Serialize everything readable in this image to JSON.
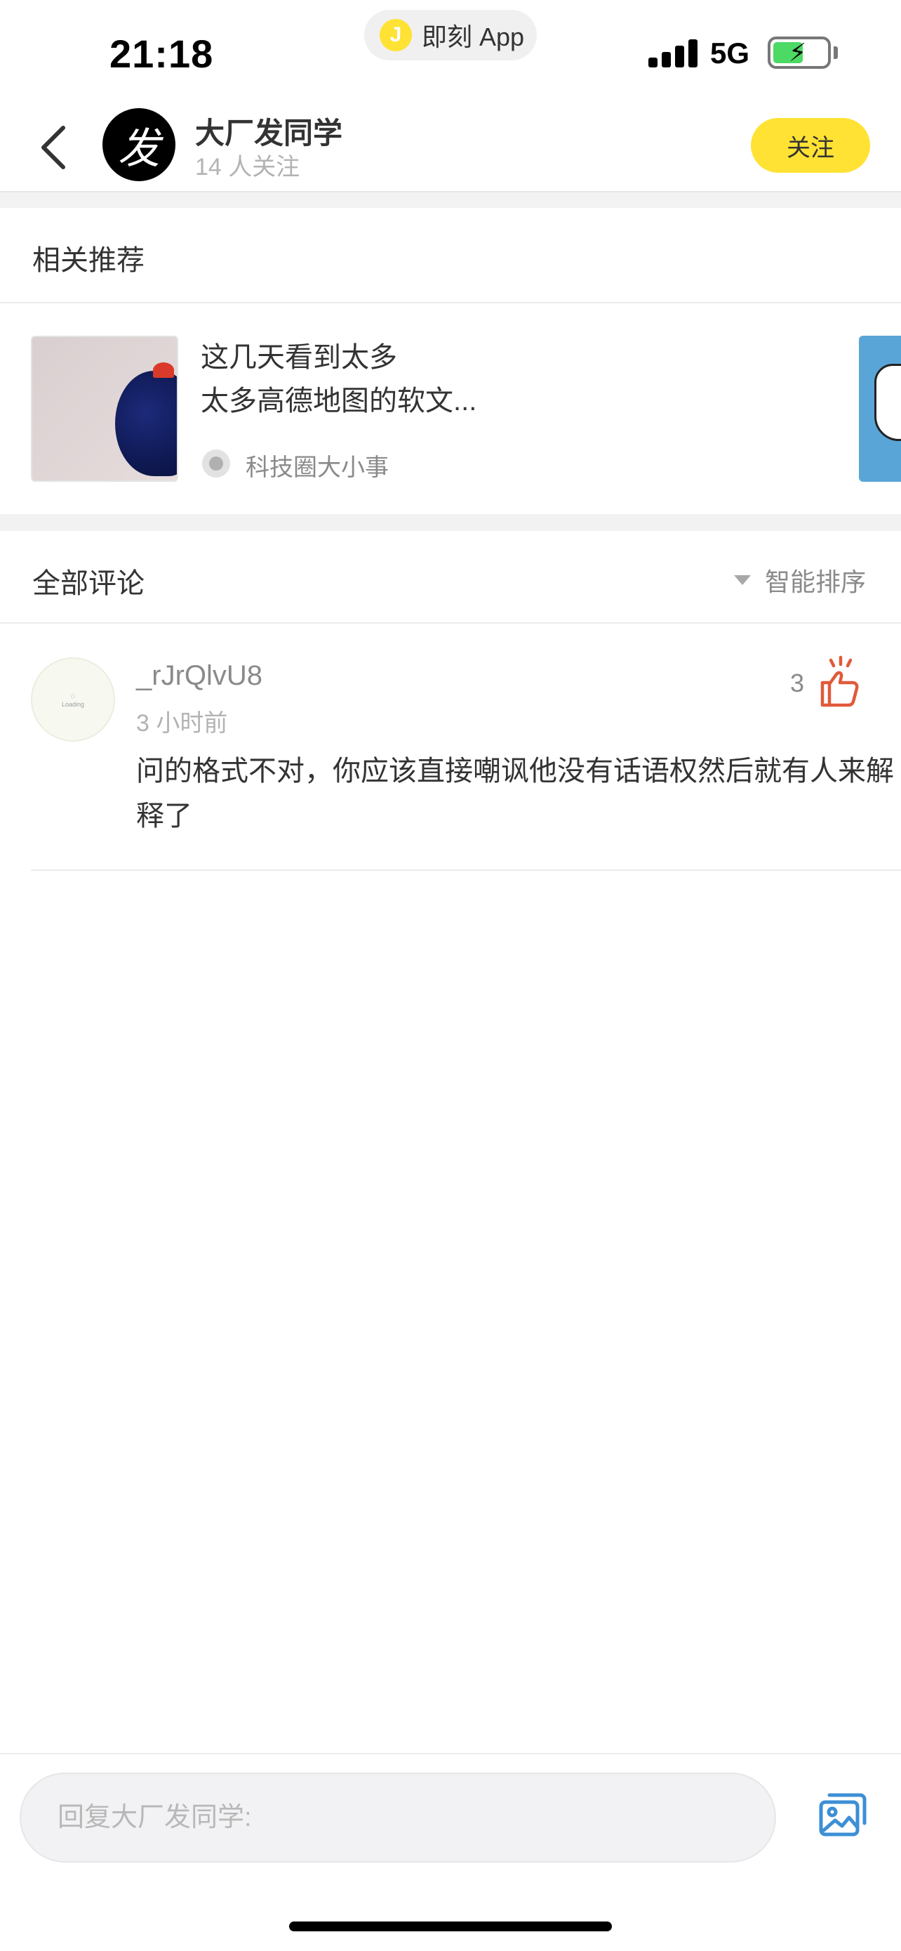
{
  "status_bar": {
    "time": "21:18",
    "app_pill_label": "即刻 App",
    "app_pill_logo": "J",
    "network": "5G",
    "icons": [
      "signal-icon",
      "battery-charging-icon"
    ]
  },
  "header": {
    "back_icon": "chevron-left-icon",
    "topic_avatar_glyph": "发",
    "topic_name": "大厂发同学",
    "followers": "14 人关注",
    "follow_label": "关注",
    "accent_color": "#ffe234"
  },
  "recommendations": {
    "title": "相关推荐",
    "items": [
      {
        "title": "这几天看到太多\n太多高德地图的软文...",
        "source": "科技圈大小事"
      }
    ]
  },
  "comments": {
    "title": "全部评论",
    "sort_label": "智能排序",
    "items": [
      {
        "avatar_loading_text": "Loading",
        "username": "_rJrQlvU8",
        "time": "3 小时前",
        "likes": "3",
        "like_color": "#e05a3a",
        "text": "问的格式不对，你应该直接嘲讽他没有话语权然后就有人来解释了"
      }
    ]
  },
  "reply_bar": {
    "placeholder": "回复大厂发同学:",
    "image_icon": "image-icon",
    "icon_color": "#3d8fd6"
  }
}
